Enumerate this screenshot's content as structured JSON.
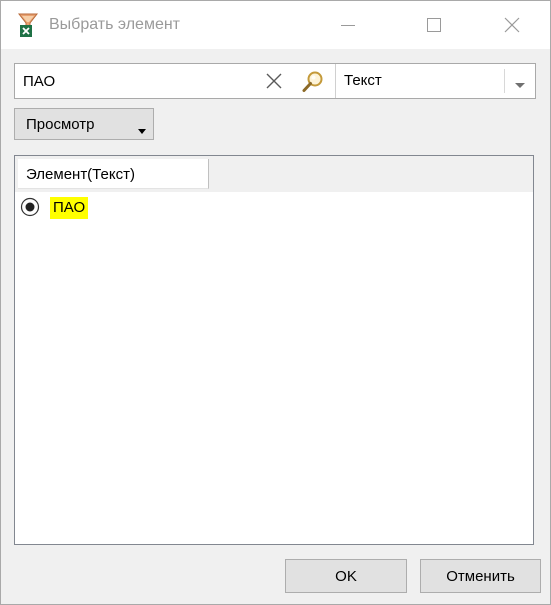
{
  "window": {
    "title": "Выбрать элемент",
    "icon": "excel-filter-icon"
  },
  "search": {
    "value": "ПАО",
    "placeholder": "",
    "clear_icon": "close-x-icon",
    "search_icon": "magnifier-icon",
    "field_value": "Текст"
  },
  "view_button": {
    "label": "Просмотр"
  },
  "list": {
    "column_header": "Элемент(Текст)",
    "items": [
      {
        "label": "ПАО",
        "selected": true,
        "highlight_color": "#ffff00"
      }
    ]
  },
  "footer": {
    "ok_label": "OK",
    "cancel_label": "Отменить"
  },
  "colors": {
    "highlight": "#ffff00",
    "window_bg": "#f0f0f0",
    "button_bg": "#e1e1e1"
  }
}
